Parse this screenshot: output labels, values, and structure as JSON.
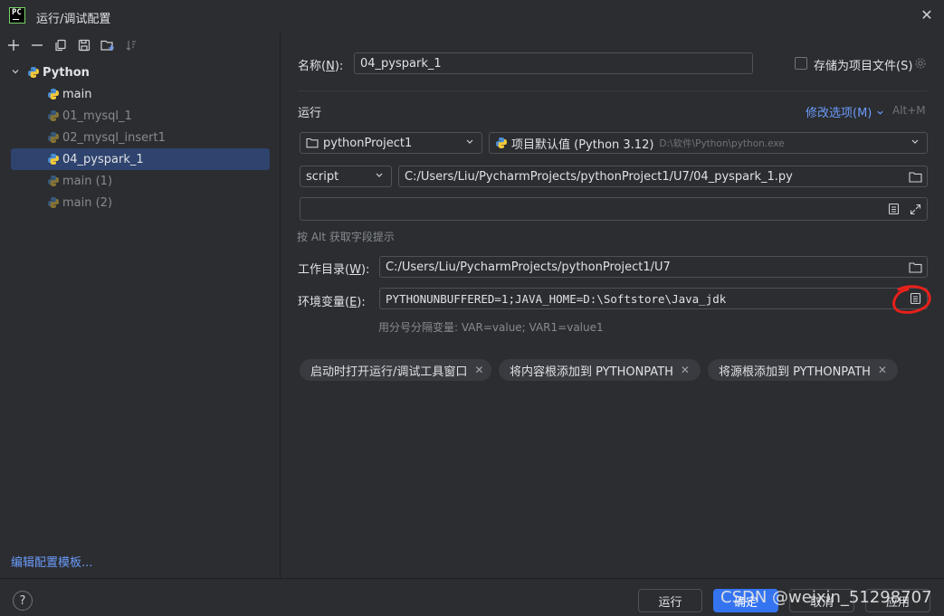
{
  "window": {
    "title": "运行/调试配置",
    "logo_text": "PC"
  },
  "left": {
    "toolbar_icons": [
      "add-icon",
      "remove-icon",
      "copy-icon",
      "save-icon",
      "new-folder-icon",
      "sort-icon"
    ],
    "tree": {
      "root": "Python",
      "items": [
        "main",
        "01_mysql_1",
        "02_mysql_insert1",
        "04_pyspark_1",
        "main (1)",
        "main (2)"
      ],
      "selected": "04_pyspark_1"
    },
    "edit_templates": "编辑配置模板..."
  },
  "form": {
    "name_label": "名称(",
    "name_mnemonic": "N",
    "name_label_end": "):",
    "name_value": "04_pyspark_1",
    "store_as_project_label": "存储为项目文件(S)",
    "run_section": "运行",
    "modify_options": "修改选项(M)",
    "modify_shortcut": "Alt+M",
    "project_dropdown": "pythonProject1",
    "interpreter_dropdown": "项目默认值 (Python 3.12)",
    "interpreter_path": "D:\\软件\\Python\\python.exe",
    "script_type": "script",
    "script_path": "C:/Users/Liu/PycharmProjects/pythonProject1/U7/04_pyspark_1.py",
    "params_value": "",
    "alt_hint": "按 Alt 获取字段提示",
    "workdir_label": "工作目录(",
    "workdir_mnemonic": "W",
    "workdir_label_end": "):",
    "workdir_value": "C:/Users/Liu/PycharmProjects/pythonProject1/U7",
    "env_label": "环境变量(",
    "env_mnemonic": "E",
    "env_label_end": "):",
    "env_value": "PYTHONUNBUFFERED=1;JAVA_HOME=D:\\Softstore\\Java_jdk",
    "env_hint": "用分号分隔变量: VAR=value; VAR1=value1",
    "chips": [
      "启动时打开运行/调试工具窗口",
      "将内容根添加到 PYTHONPATH",
      "将源根添加到 PYTHONPATH"
    ]
  },
  "footer": {
    "help": "?",
    "run_button": "运行",
    "ok_button": "确定",
    "cancel_button": "取消",
    "apply_button": "应用"
  },
  "watermark": "CSDN @weixin_51298707",
  "colors": {
    "accent": "#3574f0",
    "link": "#6b9bfa",
    "selection": "#2e436e",
    "annotation": "#e8201a"
  }
}
